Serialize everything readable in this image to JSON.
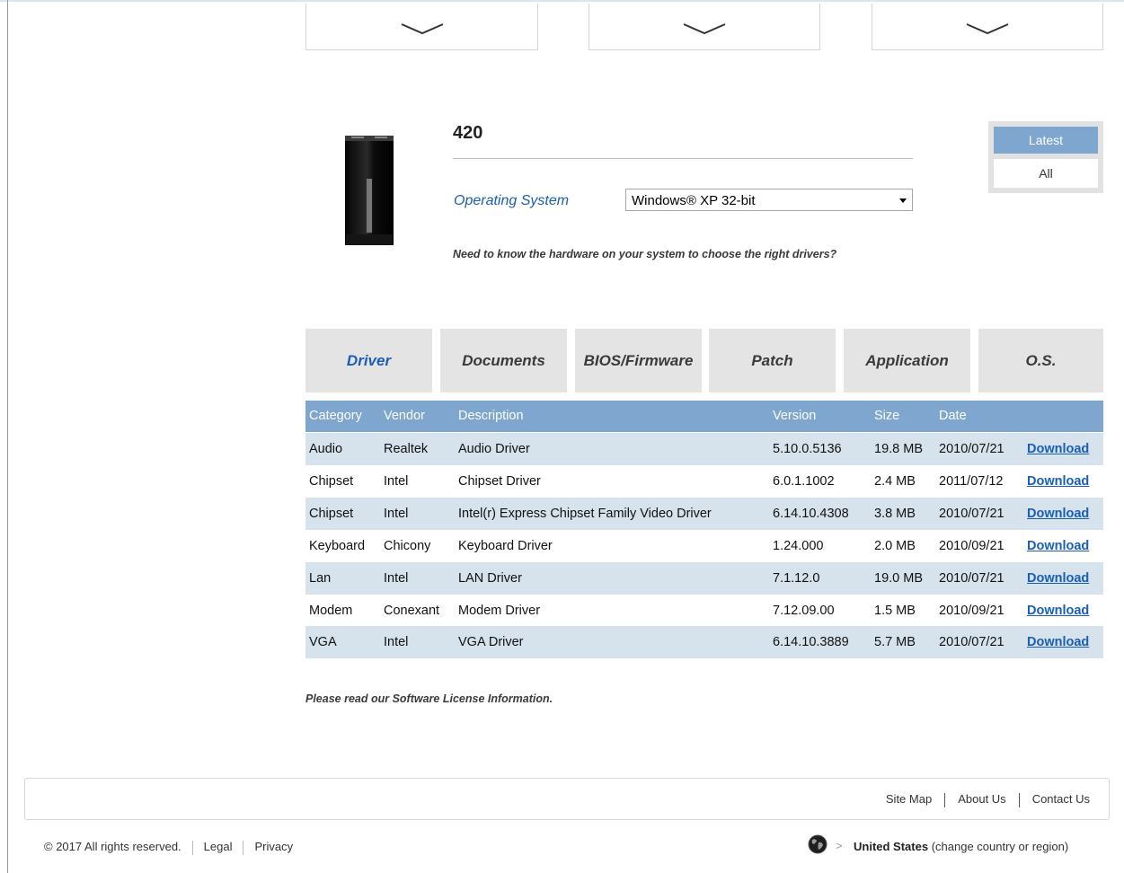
{
  "product": {
    "title": "420",
    "os_label": "Operating System",
    "os_selected": "Windows® XP 32-bit",
    "hardware_note": "Need to know the hardware on your system to choose the right drivers?"
  },
  "filter": {
    "latest": "Latest",
    "all": "All"
  },
  "tabs": [
    "Driver",
    "Documents",
    "BIOS/Firmware",
    "Patch",
    "Application",
    "O.S."
  ],
  "table": {
    "headers": {
      "category": "Category",
      "vendor": "Vendor",
      "description": "Description",
      "version": "Version",
      "size": "Size",
      "date": "Date"
    },
    "rows": [
      {
        "category": "Audio",
        "vendor": "Realtek",
        "description": "Audio Driver",
        "version": "5.10.0.5136",
        "size": "19.8 MB",
        "date": "2010/07/21",
        "download": "Download"
      },
      {
        "category": "Chipset",
        "vendor": "Intel",
        "description": "Chipset Driver",
        "version": "6.0.1.1002",
        "size": "2.4 MB",
        "date": "2011/07/12",
        "download": "Download"
      },
      {
        "category": "Chipset",
        "vendor": "Intel",
        "description": "Intel(r) Express Chipset Family Video Driver",
        "version": "6.14.10.4308",
        "size": "3.8 MB",
        "date": "2010/07/21",
        "download": "Download"
      },
      {
        "category": "Keyboard",
        "vendor": "Chicony",
        "description": "Keyboard Driver",
        "version": "1.24.000",
        "size": "2.0 MB",
        "date": "2010/09/21",
        "download": "Download"
      },
      {
        "category": "Lan",
        "vendor": "Intel",
        "description": "LAN Driver",
        "version": "7.1.12.0",
        "size": "19.0 MB",
        "date": "2010/07/21",
        "download": "Download"
      },
      {
        "category": "Modem",
        "vendor": "Conexant",
        "description": "Modem Driver",
        "version": "7.12.09.00",
        "size": "1.5 MB",
        "date": "2010/09/21",
        "download": "Download"
      },
      {
        "category": "VGA",
        "vendor": "Intel",
        "description": "VGA Driver",
        "version": "6.14.10.3889",
        "size": "5.7 MB",
        "date": "2010/07/21",
        "download": "Download"
      }
    ]
  },
  "license_note": "Please read our Software License Information.",
  "footer": {
    "links": [
      "Site Map",
      "About Us",
      "Contact Us"
    ],
    "copyright": "© 2017 All rights reserved.",
    "legal": "Legal",
    "privacy": "Privacy",
    "region_name": "United States",
    "region_change": "(change country or region)"
  },
  "icons": {
    "dropdown": "chevron-down-icon",
    "globe": "globe-icon",
    "select_caret": "caret-down-icon"
  },
  "colors": {
    "accent_blue": "#1a5fb4",
    "table_header": "#7ea6ce",
    "row_shade": "#d6e2ec",
    "tab_bg": "#e4e4e4"
  }
}
